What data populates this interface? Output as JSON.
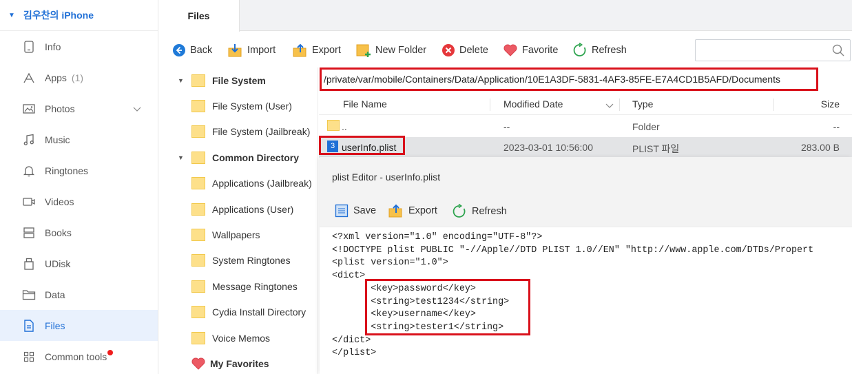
{
  "device": {
    "name": "김우찬의 iPhone",
    "caret": "▼"
  },
  "sidebar": {
    "items": [
      {
        "label": "Info",
        "icon": "phone-info-icon"
      },
      {
        "label": "Apps",
        "count": "(1)",
        "icon": "apps-icon"
      },
      {
        "label": "Photos",
        "icon": "photos-icon",
        "chevron": true
      },
      {
        "label": "Music",
        "icon": "music-icon"
      },
      {
        "label": "Ringtones",
        "icon": "bell-icon"
      },
      {
        "label": "Videos",
        "icon": "video-icon"
      },
      {
        "label": "Books",
        "icon": "books-icon"
      },
      {
        "label": "UDisk",
        "icon": "udisk-icon"
      },
      {
        "label": "Data",
        "icon": "folder-icon"
      },
      {
        "label": "Files",
        "icon": "file-icon",
        "active": true
      },
      {
        "label": "Common tools",
        "icon": "grid-icon",
        "badge": true
      }
    ]
  },
  "tabs": [
    {
      "label": "Files"
    }
  ],
  "toolbar": {
    "back": "Back",
    "import": "Import",
    "export": "Export",
    "new_folder": "New Folder",
    "delete": "Delete",
    "favorite": "Favorite",
    "refresh": "Refresh",
    "search_placeholder": ""
  },
  "tree": {
    "groups": [
      {
        "label": "File System",
        "children": [
          "File System (User)",
          "File System (Jailbreak)"
        ]
      },
      {
        "label": "Common Directory",
        "children": [
          "Applications (Jailbreak)",
          "Applications (User)",
          "Wallpapers",
          "System Ringtones",
          "Message Ringtones",
          "Cydia Install Directory",
          "Voice Memos"
        ]
      }
    ],
    "favorites": "My Favorites"
  },
  "path": "/private/var/mobile/Containers/Data/Application/10E1A3DF-5831-4AF3-85FE-E7A4CD1B5AFD/Documents",
  "columns": {
    "name": "File Name",
    "modified": "Modified Date",
    "type": "Type",
    "size": "Size"
  },
  "files": [
    {
      "name": "..",
      "modified": "--",
      "type": "Folder",
      "size": "--"
    },
    {
      "name": "userInfo.plist",
      "modified": "2023-03-01 10:56:00",
      "type": "PLIST 파일",
      "size": "283.00 B",
      "selected": true
    }
  ],
  "editor": {
    "title": "plist Editor - userInfo.plist",
    "save": "Save",
    "export": "Export",
    "refresh": "Refresh",
    "lines": [
      "<?xml version=\"1.0\" encoding=\"UTF-8\"?>",
      "<!DOCTYPE plist PUBLIC \"-//Apple//DTD PLIST 1.0//EN\" \"http://www.apple.com/DTDs/Propert",
      "<plist version=\"1.0\">",
      "<dict>",
      "       <key>password</key>",
      "       <string>test1234</string>",
      "       <key>username</key>",
      "       <string>tester1</string>",
      "</dict>",
      "</plist>"
    ]
  },
  "colors": {
    "accent": "#1f6fd6",
    "highlight_box": "#d9111b",
    "active_bg": "#e9f1fd"
  }
}
